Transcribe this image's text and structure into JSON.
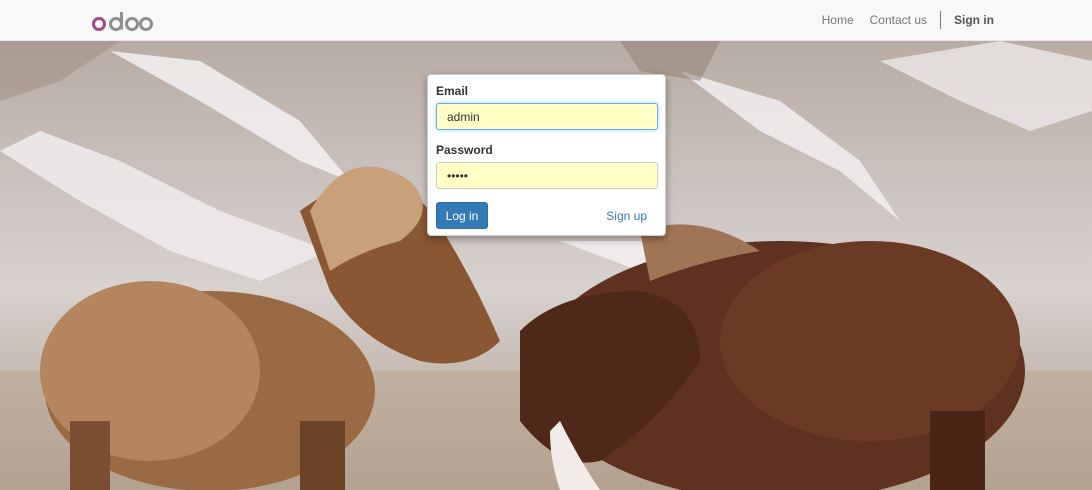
{
  "brand": {
    "logo_text": "odoo"
  },
  "nav": {
    "items": [
      {
        "label": "Home"
      },
      {
        "label": "Contact us"
      }
    ],
    "signin_label": "Sign in"
  },
  "login": {
    "email_label": "Email",
    "email_value": "admin",
    "password_label": "Password",
    "password_display": "•••••",
    "login_button": "Log in",
    "signup_link": "Sign up"
  },
  "colors": {
    "primary": "#337ab7",
    "autofill": "#ffffc6",
    "navbar_bg": "#f8f8f8"
  },
  "background": {
    "icon": "horses-photo"
  }
}
